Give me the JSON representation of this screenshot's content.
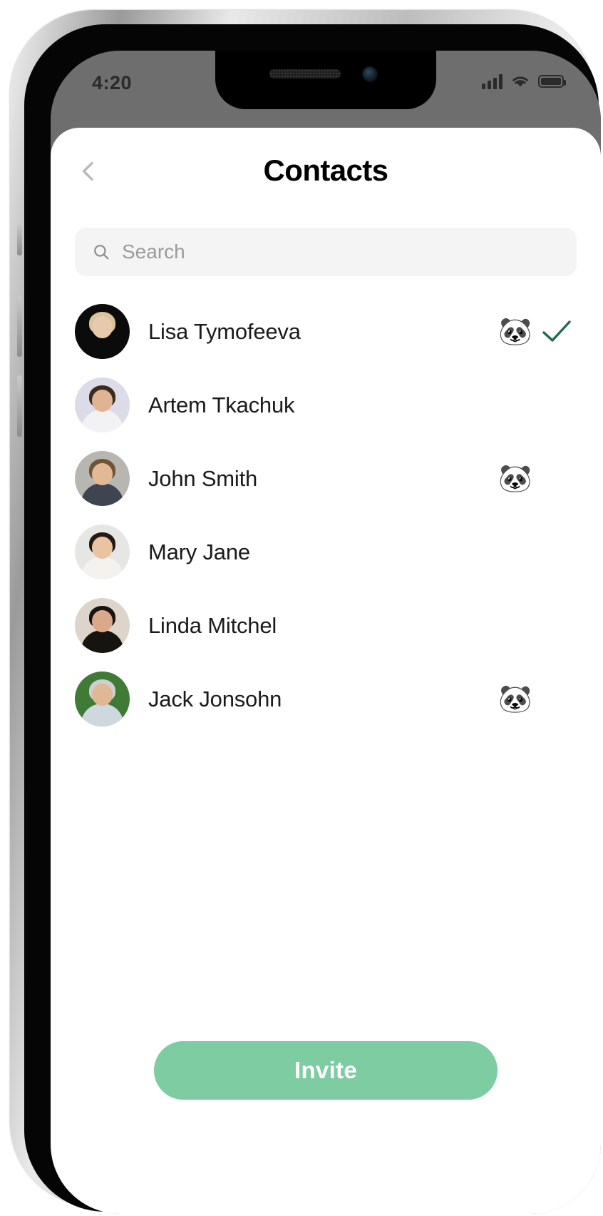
{
  "status_bar": {
    "time": "4:20",
    "signal_icon": "cellular-bars-icon",
    "wifi_icon": "wifi-icon",
    "battery_icon": "battery-full-icon"
  },
  "nav": {
    "back_icon": "chevron-left-icon",
    "title": "Contacts"
  },
  "search": {
    "icon": "search-icon",
    "placeholder": "Search",
    "value": ""
  },
  "contacts": [
    {
      "name": "Lisa Tymofeeva",
      "badge": "🐼",
      "has_badge": true,
      "selected": true,
      "avatar": {
        "bg": "#0b0b0b",
        "skin": "#e8c9ae",
        "hair": "#d8c39b",
        "clothes": "#0b0b0b"
      }
    },
    {
      "name": "Artem Tkachuk",
      "badge": "",
      "has_badge": false,
      "selected": false,
      "avatar": {
        "bg": "#dcdce8",
        "skin": "#e0b392",
        "hair": "#3a2a20",
        "clothes": "#f2f2f4"
      }
    },
    {
      "name": "John Smith",
      "badge": "🐼",
      "has_badge": true,
      "selected": false,
      "avatar": {
        "bg": "#b8b6b1",
        "skin": "#e3b895",
        "hair": "#6e5434",
        "clothes": "#3e4450"
      }
    },
    {
      "name": "Mary Jane",
      "badge": "",
      "has_badge": false,
      "selected": false,
      "avatar": {
        "bg": "#e6e6e4",
        "skin": "#eac3a1",
        "hair": "#241a14",
        "clothes": "#f4f2ef"
      }
    },
    {
      "name": "Linda Mitchel",
      "badge": "",
      "has_badge": false,
      "selected": false,
      "avatar": {
        "bg": "#ddd5cb",
        "skin": "#d9a98a",
        "hair": "#1a1410",
        "clothes": "#17140f"
      }
    },
    {
      "name": "Jack Jonsohn",
      "badge": "🐼",
      "has_badge": true,
      "selected": false,
      "avatar": {
        "bg": "#3f7a37",
        "skin": "#e0b896",
        "hair": "#cfcfcf",
        "clothes": "#cfd8df"
      }
    }
  ],
  "footer": {
    "invite_label": "Invite"
  },
  "colors": {
    "accent_green": "#7ecca2",
    "check_green": "#1f6b4a",
    "search_bg": "#f4f4f4",
    "status_bg": "#6e6e6e",
    "title_color": "#000000"
  }
}
